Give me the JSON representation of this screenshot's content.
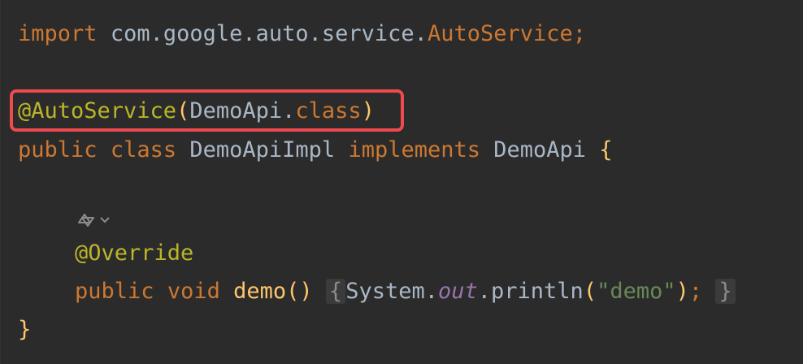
{
  "code": {
    "line1": {
      "import_kw": "import",
      "package": "com.google.auto.service.",
      "imported_class": "AutoService",
      "semicolon": ";"
    },
    "line3": {
      "annotation": "@AutoService",
      "open_paren": "(",
      "arg_class": "DemoApi",
      "dot": ".",
      "class_kw": "class",
      "close_paren": ")"
    },
    "line4": {
      "public_kw": "public",
      "class_kw": "class",
      "class_name": "DemoApiImpl",
      "implements_kw": "implements",
      "interface_name": "DemoApi",
      "open_brace": "{"
    },
    "line6": {
      "annotation": "@Override"
    },
    "line7": {
      "public_kw": "public",
      "void_kw": "void",
      "method_name": "demo",
      "parens": "()",
      "fold_open": "{",
      "system": "System.",
      "out_field": "out",
      "println": ".println",
      "open_paren": "(",
      "string": "\"demo\"",
      "close_paren": ")",
      "semicolon": ";",
      "fold_close": "}"
    },
    "line8": {
      "close_brace": "}"
    }
  },
  "icons": {
    "hint": "implementation-gutter-icon",
    "chevron": "chevron-down-icon"
  }
}
